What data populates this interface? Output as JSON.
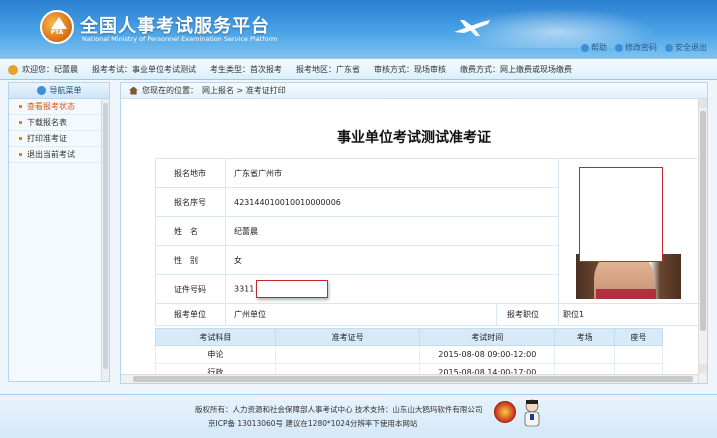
{
  "header": {
    "title": "全国人事考试服务平台",
    "subtitle": "National Ministry of Personnel Examination Service Platform",
    "logo_text": "PTA",
    "links": [
      {
        "icon": "help-icon",
        "label": "帮助"
      },
      {
        "icon": "key-icon",
        "label": "修改密码"
      },
      {
        "icon": "logout-icon",
        "label": "安全退出"
      }
    ]
  },
  "infobar": {
    "welcome": "欢迎您：纪蕾晨",
    "exam": "报考考试：事业单位考试测试",
    "exam_type": "考生类型：首次报考",
    "region": "报考地区：广东省",
    "review": "审核方式：现场审核",
    "payment": "缴费方式：网上缴费或现场缴费"
  },
  "sidebar": {
    "heading": "导航菜单",
    "items": [
      {
        "label": "查看报考状态",
        "active": true
      },
      {
        "label": "下载报名表",
        "active": false
      },
      {
        "label": "打印准考证",
        "active": false
      },
      {
        "label": "退出当前考试",
        "active": false
      }
    ]
  },
  "breadcrumb": {
    "prefix": "您现在的位置：",
    "path": "网上报名 > 准考证打印"
  },
  "document": {
    "title": "事业单位考试测试准考证",
    "fields": [
      {
        "label": "报名地市",
        "value": "广东省广州市"
      },
      {
        "label": "报名序号",
        "value": "423144010010010000006"
      },
      {
        "label": "姓　名",
        "value": "纪蕾晨"
      },
      {
        "label": "性　别",
        "value": "女"
      },
      {
        "label": "证件号码",
        "value": "3311"
      }
    ],
    "unit_label": "报考单位",
    "unit_value": "广州单位",
    "position_label": "报考职位",
    "position_value": "职位1"
  },
  "exam_table": {
    "headers": [
      "考试科目",
      "准考证号",
      "考试时间",
      "考场",
      "座号"
    ],
    "rows": [
      [
        "申论",
        "",
        "2015-08-08 09:00-12:00",
        "",
        ""
      ],
      [
        "行政",
        "",
        "2015-08-08 14:00-17:00",
        "",
        ""
      ]
    ]
  },
  "footer": {
    "line1": "版权所有：人力资源和社会保障部人事考试中心  技术支持：山东山大鸥玛软件有限公司",
    "line2": "京ICP备 13013060号  建议在1280*1024分辨率下使用本网站"
  }
}
